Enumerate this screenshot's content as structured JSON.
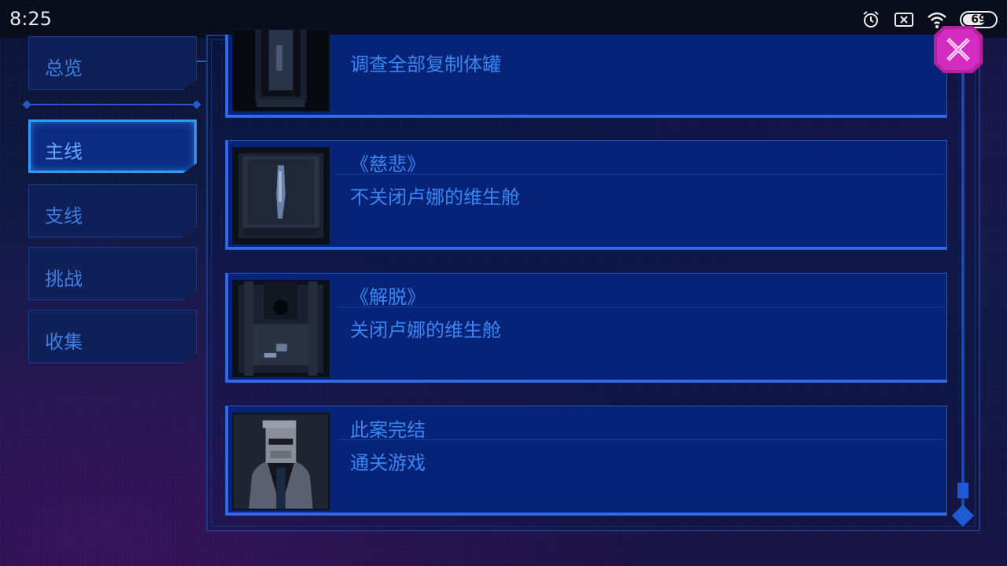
{
  "status_bar": {
    "time": "8:25",
    "icons": [
      "alarm-icon",
      "notification-off-icon",
      "wifi-icon"
    ],
    "battery_level": "69",
    "battery_fraction": 0.69
  },
  "sidebar": {
    "items": [
      {
        "label": "总览",
        "active": false
      },
      {
        "label": "主线",
        "active": true
      },
      {
        "label": "支线",
        "active": false
      },
      {
        "label": "挑战",
        "active": false
      },
      {
        "label": "收集",
        "active": false
      }
    ]
  },
  "quests": [
    {
      "title": "",
      "desc": "调查全部复制体罐",
      "thumb_icon": "specimen-tank-icon"
    },
    {
      "title": "《慈悲》",
      "desc": "不关闭卢娜的维生舱",
      "thumb_icon": "life-pod-icon"
    },
    {
      "title": "《解脱》",
      "desc": "关闭卢娜的维生舱",
      "thumb_icon": "closed-pod-icon"
    },
    {
      "title": "此案完结",
      "desc": "通关游戏",
      "thumb_icon": "detective-portrait-icon"
    }
  ],
  "close_button": {
    "icon": "close-icon"
  },
  "colors": {
    "accent": "#2f9cff",
    "text": "#3a86f0",
    "panel": "#062378",
    "close": "#d22dc0"
  }
}
